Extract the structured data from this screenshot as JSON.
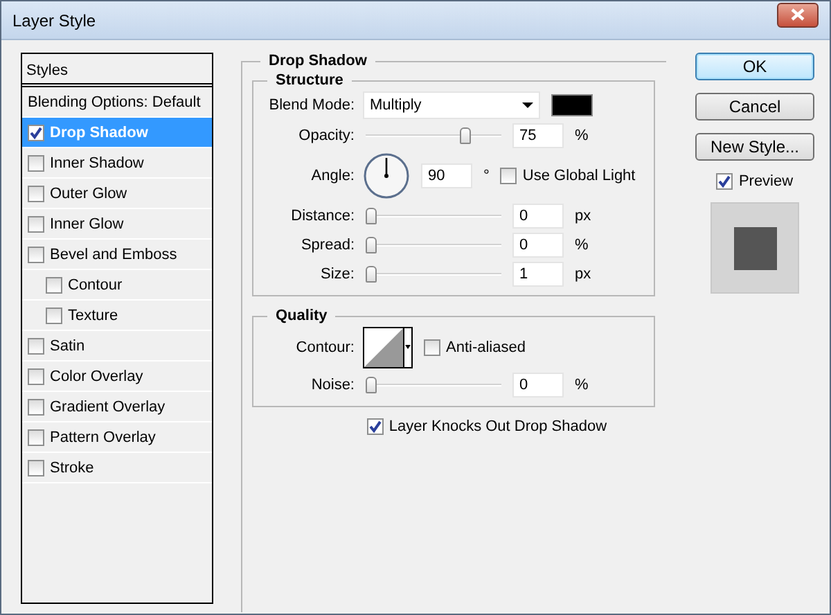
{
  "window": {
    "title": "Layer Style"
  },
  "styles": {
    "header": "Styles",
    "items": [
      {
        "kind": "plain",
        "label": "Blending Options: Default",
        "selected": false
      },
      {
        "kind": "check",
        "label": "Drop Shadow",
        "checked": true,
        "selected": true
      },
      {
        "kind": "check",
        "label": "Inner Shadow",
        "checked": false,
        "selected": false
      },
      {
        "kind": "check",
        "label": "Outer Glow",
        "checked": false,
        "selected": false
      },
      {
        "kind": "check",
        "label": "Inner Glow",
        "checked": false,
        "selected": false
      },
      {
        "kind": "check",
        "label": "Bevel and Emboss",
        "checked": false,
        "selected": false,
        "children": [
          {
            "kind": "check",
            "label": "Contour",
            "checked": false,
            "selected": false
          },
          {
            "kind": "check",
            "label": "Texture",
            "checked": false,
            "selected": false
          }
        ]
      },
      {
        "kind": "check",
        "label": "Satin",
        "checked": false,
        "selected": false
      },
      {
        "kind": "check",
        "label": "Color Overlay",
        "checked": false,
        "selected": false
      },
      {
        "kind": "check",
        "label": "Gradient Overlay",
        "checked": false,
        "selected": false
      },
      {
        "kind": "check",
        "label": "Pattern Overlay",
        "checked": false,
        "selected": false
      },
      {
        "kind": "check",
        "label": "Stroke",
        "checked": false,
        "selected": false
      }
    ]
  },
  "drop_shadow": {
    "title": "Drop Shadow",
    "structure": {
      "title": "Structure",
      "blend_mode": {
        "label": "Blend Mode:",
        "value": "Multiply"
      },
      "opacity": {
        "label": "Opacity:",
        "value": "75",
        "unit": "%",
        "level": 0.75
      },
      "angle": {
        "label": "Angle:",
        "value": "90",
        "unit": "°"
      },
      "use_global_light": {
        "label": "Use Global Light",
        "checked": false
      },
      "distance": {
        "label": "Distance:",
        "value": "0",
        "unit": "px",
        "level": 0
      },
      "spread": {
        "label": "Spread:",
        "value": "0",
        "unit": "%",
        "level": 0
      },
      "size": {
        "label": "Size:",
        "value": "1",
        "unit": "px",
        "level": 0
      }
    },
    "quality": {
      "title": "Quality",
      "contour": {
        "label": "Contour:"
      },
      "anti_aliased": {
        "label": "Anti-aliased",
        "checked": false
      },
      "noise": {
        "label": "Noise:",
        "value": "0",
        "unit": "%",
        "level": 0
      }
    },
    "knocks_out": {
      "label": "Layer Knocks Out Drop Shadow",
      "checked": true
    }
  },
  "buttons": [
    {
      "label": "OK",
      "default": true
    },
    {
      "label": "Cancel",
      "default": false
    },
    {
      "label": "New Style...",
      "default": false
    }
  ],
  "preview": {
    "label": "Preview",
    "checked": true
  }
}
